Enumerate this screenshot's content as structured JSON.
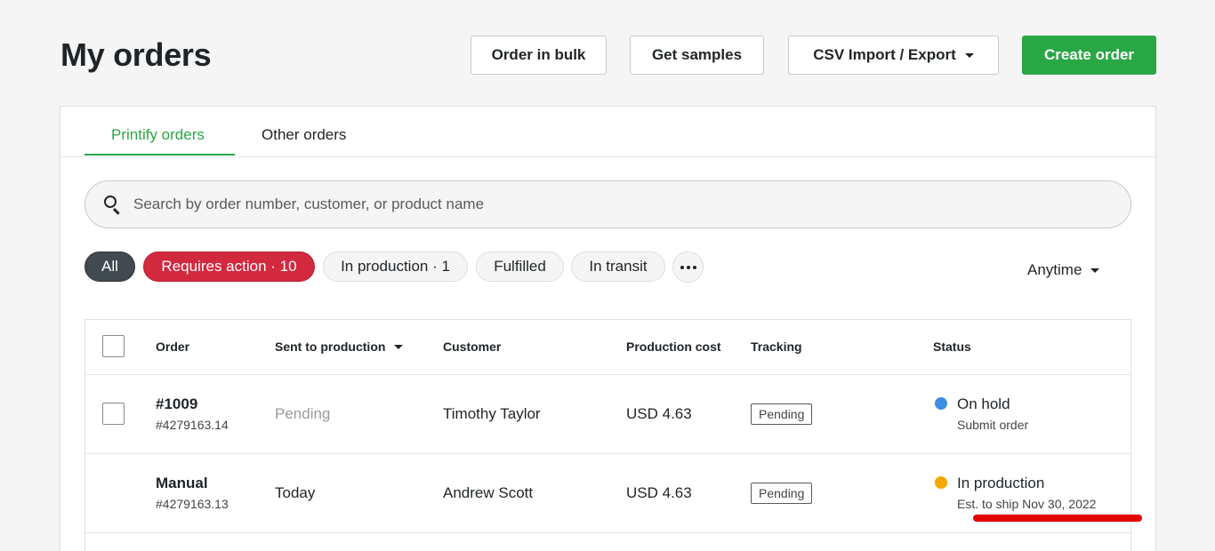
{
  "header": {
    "title": "My orders",
    "buttons": {
      "bulk": "Order in bulk",
      "samples": "Get samples",
      "csv": "CSV Import / Export",
      "create": "Create order"
    }
  },
  "tabs": {
    "printify": "Printify orders",
    "other": "Other orders"
  },
  "search": {
    "placeholder": "Search by order number, customer, or product name"
  },
  "filters": {
    "all": "All",
    "requires_action": "Requires action · 10",
    "in_production": "In production · 1",
    "fulfilled": "Fulfilled",
    "in_transit": "In transit",
    "time": "Anytime"
  },
  "table": {
    "headers": {
      "order": "Order",
      "sent": "Sent to production",
      "customer": "Customer",
      "cost": "Production cost",
      "tracking": "Tracking",
      "status": "Status"
    },
    "rows": [
      {
        "order": "#1009",
        "order_id": "#4279163.14",
        "sent": "Pending",
        "customer": "Timothy Taylor",
        "cost": "USD 4.63",
        "tracking": "Pending",
        "status": "On hold",
        "status_sub": "Submit order",
        "status_color": "#3d8ee0"
      },
      {
        "order": "Manual",
        "order_id": "#4279163.13",
        "sent": "Today",
        "customer": "Andrew Scott",
        "cost": "USD 4.63",
        "tracking": "Pending",
        "status": "In production",
        "status_sub": "Est. to ship Nov 30, 2022",
        "status_color": "#f5a800"
      }
    ]
  },
  "colors": {
    "accent": "#29a745",
    "danger": "#d3293f",
    "highlight": "#e20000"
  }
}
